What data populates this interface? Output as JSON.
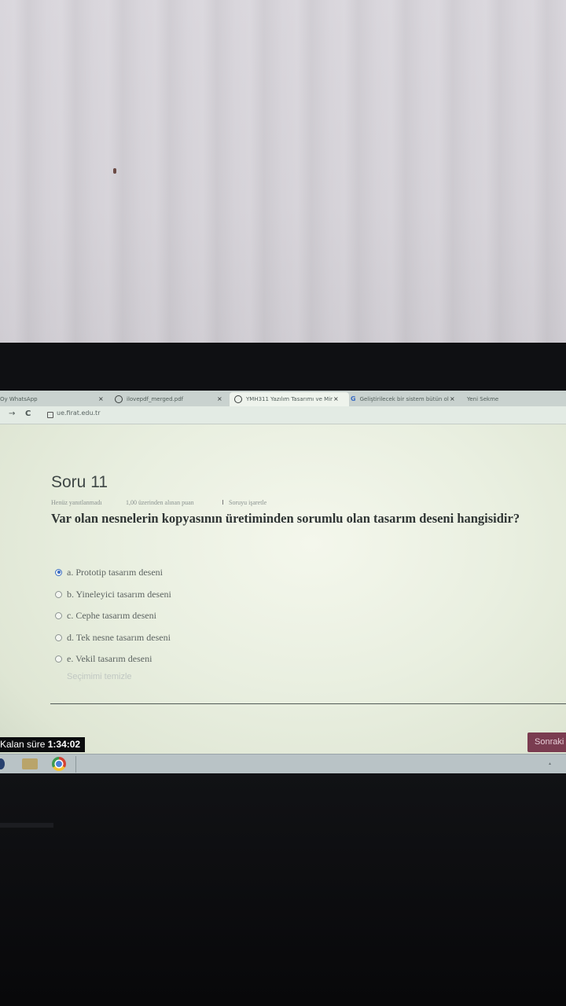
{
  "browser": {
    "tabs": [
      {
        "label": "Oy WhatsApp",
        "closable": true
      },
      {
        "label": "ilovepdf_merged.pdf",
        "closable": true
      },
      {
        "label": "YMH311 Yazılım Tasarımı ve Mir",
        "closable": true,
        "active": true
      },
      {
        "label": "Geliştirilecek bir sistem bütün ol",
        "closable": true
      },
      {
        "label": "Yeni Sekme",
        "closable": false
      }
    ],
    "close_glyph": "×",
    "url": "ue.firat.edu.tr"
  },
  "quiz": {
    "question_title": "Soru 11",
    "status": "Henüz yanıtlanmadı",
    "points": "1,00 üzerinden alınan puan",
    "flag_label": "Soruyu işaretle",
    "question_text": "Var olan nesnelerin kopyasının üretiminden sorumlu olan tasarım deseni hangisidir?",
    "options": [
      {
        "label": "a. Prototip tasarım deseni",
        "selected": true
      },
      {
        "label": "b. Yineleyici tasarım deseni",
        "selected": false
      },
      {
        "label": "c. Cephe tasarım deseni",
        "selected": false
      },
      {
        "label": "d. Tek nesne tasarım deseni",
        "selected": false
      },
      {
        "label": "e. Vekil tasarım deseni",
        "selected": false
      }
    ],
    "clear_choice": "Seçimimi temizle",
    "timer_label": "Kalan süre",
    "timer_value": "1:34:02",
    "next_button": "Sonraki"
  },
  "colors": {
    "accent": "#3b6dc4",
    "next_button_bg": "#7a3c50"
  },
  "icons": [
    "back-arrow-icon",
    "reload-icon",
    "lock-icon",
    "flag-icon",
    "radio-icon",
    "chrome-icon",
    "folder-icon",
    "start-icon"
  ]
}
